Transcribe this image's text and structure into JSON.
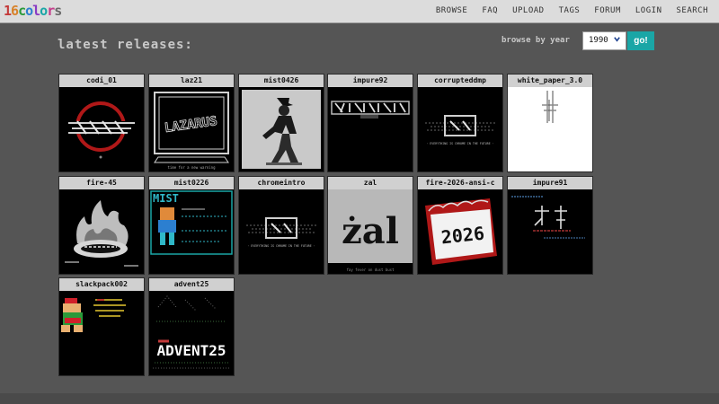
{
  "header": {
    "logo_text": "16colors",
    "nav": [
      "BROWSE",
      "FAQ",
      "UPLOAD",
      "TAGS",
      "FORUM",
      "LOGIN",
      "SEARCH"
    ]
  },
  "main": {
    "title": "latest releases:",
    "browse_label": "browse by year",
    "year_value": "1990",
    "go_label": "go!"
  },
  "art_text": {
    "lazarus_sub": "time for a new warning",
    "everything": "· EVERYTHING IS CHROME IN THE FUTURE ·",
    "zal_sub": "fay fever on dust bust",
    "year_2026": "2026",
    "zal_word": "żal",
    "advent_word": "ADVENT25",
    "mist_word": "MIST",
    "lazarus_word": "LAZARUS"
  },
  "releases": [
    {
      "name": "codi_01"
    },
    {
      "name": "laz21"
    },
    {
      "name": "mist0426"
    },
    {
      "name": "impure92"
    },
    {
      "name": "corrupteddmp"
    },
    {
      "name": "white_paper_3.0"
    },
    {
      "name": "fire-45"
    },
    {
      "name": "mist0226"
    },
    {
      "name": "chromeintro"
    },
    {
      "name": "zal"
    },
    {
      "name": "fire-2026-ansi-c"
    },
    {
      "name": "impure91"
    },
    {
      "name": "slackpack002"
    },
    {
      "name": "advent25"
    }
  ],
  "colors": {
    "accent": "#1aa6a6",
    "background": "#555555",
    "topbar": "#dcdcdc"
  }
}
